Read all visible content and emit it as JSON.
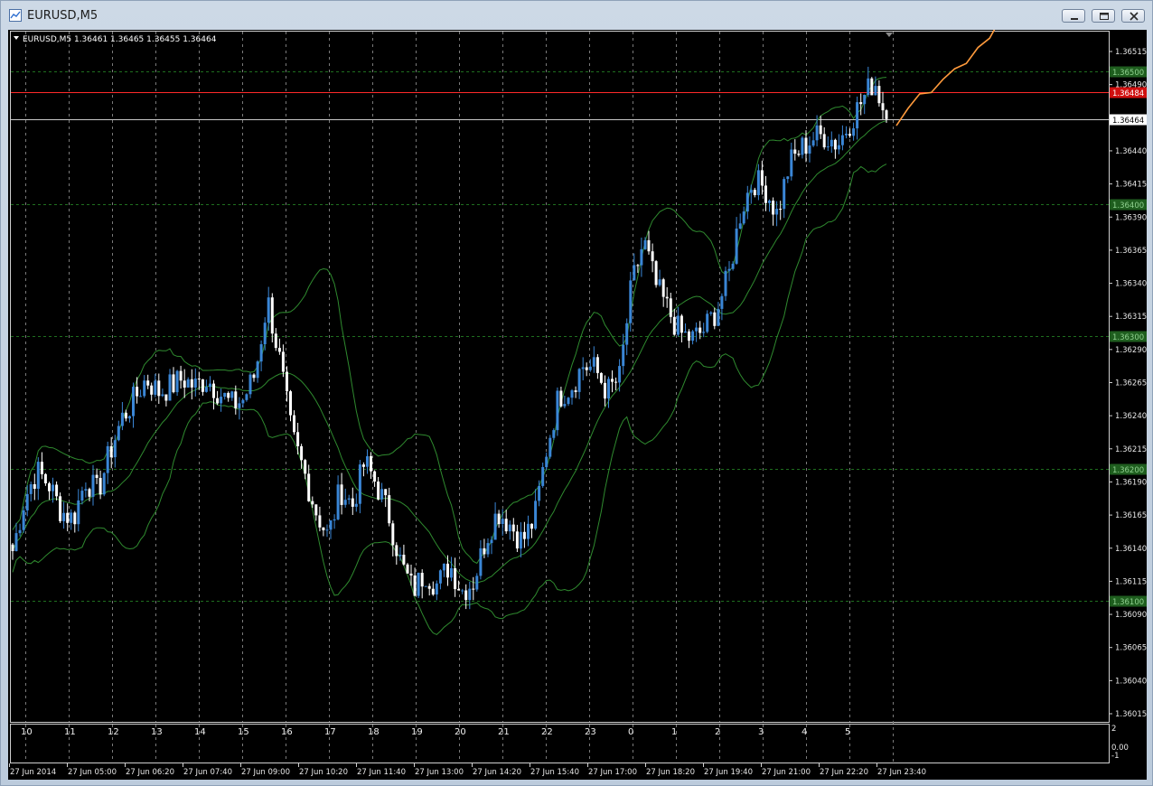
{
  "window": {
    "title": "EURUSD,M5",
    "controls": [
      "minimize",
      "maximize",
      "close"
    ]
  },
  "chart_info": {
    "symbol_ohlc": "EURUSD,M5  1.36461 1.36465 1.36455 1.36464"
  },
  "colors": {
    "background": "#000000",
    "bull_candle": "#3a86d6",
    "bear_candle": "#ffffff",
    "bands": "#2f8a2f",
    "grid": "#7a7a7a",
    "level_lines": "#1f6f1f",
    "red_line": "#ff2a2a",
    "forecast": "#ff9a3c",
    "bid_line": "#c8c8c8"
  },
  "chart_data": {
    "type": "candlestick",
    "symbol": "EURUSD",
    "timeframe": "M5",
    "ylim": [
      1.36003,
      1.36527
    ],
    "y_ticks": [
      "1.36515",
      "1.36490",
      "1.36440",
      "1.36415",
      "1.36390",
      "1.36365",
      "1.36340",
      "1.36315",
      "1.36290",
      "1.36265",
      "1.36240",
      "1.36215",
      "1.36190",
      "1.36165",
      "1.36140",
      "1.36115",
      "1.36090",
      "1.36065",
      "1.36040",
      "1.36015"
    ],
    "level_lines": [
      {
        "label": "1.36500",
        "price": 1.365
      },
      {
        "label": "1.36400",
        "price": 1.364
      },
      {
        "label": "1.36300",
        "price": 1.363
      },
      {
        "label": "1.36200",
        "price": 1.362
      },
      {
        "label": "1.36100",
        "price": 1.361
      }
    ],
    "red_line": {
      "label": "1.36484",
      "price": 1.36484
    },
    "bid_line": {
      "label": "1.36464",
      "price": 1.36464
    },
    "x_ticks_top": [
      "10",
      "11",
      "12",
      "13",
      "14",
      "15",
      "16",
      "17",
      "18",
      "19",
      "20",
      "21",
      "22",
      "23",
      "0",
      "1",
      "2",
      "3",
      "4",
      "5"
    ],
    "x_ticks_bottom": [
      "27 Jun 2014",
      "27 Jun 05:00",
      "27 Jun 06:20",
      "27 Jun 07:40",
      "27 Jun 09:00",
      "27 Jun 10:20",
      "27 Jun 11:40",
      "27 Jun 13:00",
      "27 Jun 14:20",
      "27 Jun 15:40",
      "27 Jun 17:00",
      "27 Jun 18:20",
      "27 Jun 19:40",
      "27 Jun 21:00",
      "27 Jun 22:20",
      "27 Jun 23:40"
    ],
    "close_path": [
      1.36138,
      1.36178,
      1.36198,
      1.36188,
      1.36168,
      1.36162,
      1.36192,
      1.36182,
      1.36212,
      1.36238,
      1.36252,
      1.36268,
      1.36258,
      1.36262,
      1.36268,
      1.36262,
      1.36268,
      1.36258,
      1.36248,
      1.36252,
      1.36272,
      1.36328,
      1.36282,
      1.36225,
      1.36198,
      1.36168,
      1.36148,
      1.36185,
      1.36172,
      1.36205,
      1.36188,
      1.36165,
      1.36128,
      1.36108,
      1.36122,
      1.36112,
      1.36128,
      1.36108,
      1.36115,
      1.36148,
      1.36168,
      1.36158,
      1.36145,
      1.36162,
      1.36215,
      1.36255,
      1.36262,
      1.36278,
      1.36275,
      1.36258,
      1.36268,
      1.36338,
      1.36372,
      1.36338,
      1.3632,
      1.36302,
      1.36298,
      1.36305,
      1.3632,
      1.36345,
      1.36395,
      1.36418,
      1.36412,
      1.36392,
      1.3643,
      1.36442,
      1.3645,
      1.36452,
      1.36445,
      1.36462,
      1.36478,
      1.36494,
      1.36464
    ],
    "bands": {
      "period": 20,
      "deviations": 2
    },
    "forecast_path": [
      1.36459,
      1.36472,
      1.36483,
      1.36484,
      1.36494,
      1.36502,
      1.36506,
      1.36518,
      1.36525,
      1.36541,
      1.36553
    ],
    "indicator_window": {
      "ticks": [
        "2",
        "0.00",
        "-1"
      ]
    }
  }
}
